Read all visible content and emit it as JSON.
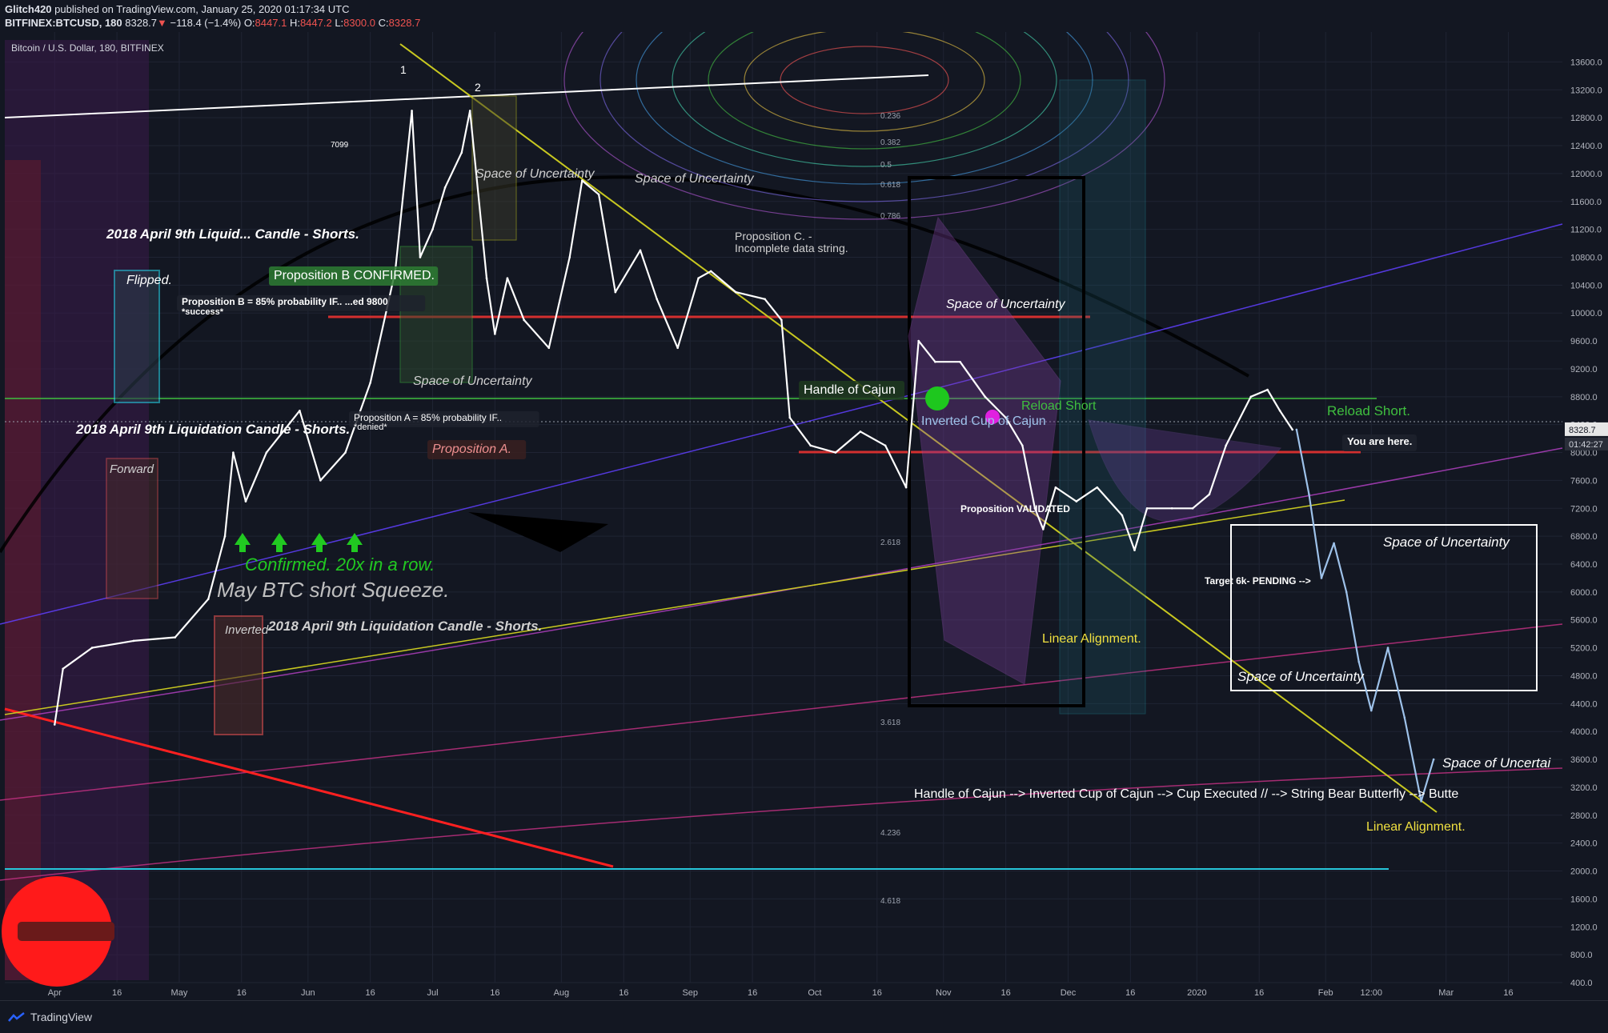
{
  "header": {
    "line1_user": "Glitch420",
    "line1_rest": " published on TradingView.com, January 25, 2020 01:17:34 UTC",
    "symbol": "BITFINEX:BTCUSD, 180",
    "last": "8328.7",
    "change": "−118.4 (−1.4%)",
    "o_label": "O:",
    "o": "8447.1",
    "h_label": "H:",
    "h": "8447.2",
    "l_label": "L:",
    "l": "8300.0",
    "c_label": "C:",
    "c": "8328.7"
  },
  "chart_title": "Bitcoin / U.S. Dollar, 180, BITFINEX",
  "footer": {
    "brand": "TradingView"
  },
  "colors": {
    "background": "#131722",
    "price_line": "#ffffff",
    "up": "#26a69a",
    "down": "#ef5350",
    "grid": "#1f2433"
  },
  "chart_data": {
    "type": "line",
    "title": "Bitcoin / U.S. Dollar, 180, BITFINEX",
    "xlabel": "",
    "ylabel": "",
    "ylim": [
      400,
      13800
    ],
    "y_ticks": [
      "13600.0",
      "13200.0",
      "12800.0",
      "12400.0",
      "12000.0",
      "11600.0",
      "11200.0",
      "10800.0",
      "10400.0",
      "10000.0",
      "9600.0",
      "9200.0",
      "8800.0",
      "8400.0",
      "8000.0",
      "7600.0",
      "7200.0",
      "6800.0",
      "6400.0",
      "6000.0",
      "5600.0",
      "5200.0",
      "4800.0",
      "4400.0",
      "4000.0",
      "3600.0",
      "3200.0",
      "2800.0",
      "2400.0",
      "2000.0",
      "1600.0",
      "1200.0",
      "800.0",
      "400.0"
    ],
    "x_ticks": [
      "Apr",
      "16",
      "May",
      "16",
      "Jun",
      "16",
      "Jul",
      "16",
      "Aug",
      "16",
      "Sep",
      "16",
      "Oct",
      "16",
      "Nov",
      "16",
      "Dec",
      "16",
      "2020",
      "16",
      "Feb",
      "12:00",
      "Mar",
      "16"
    ],
    "price_label": "8328.7",
    "countdown_label": "01:42:27",
    "series": [
      {
        "values": [
          [
            "2019-04-01",
            4100
          ],
          [
            "2019-04-03",
            4900
          ],
          [
            "2019-04-10",
            5200
          ],
          [
            "2019-04-20",
            5300
          ],
          [
            "2019-04-30",
            5350
          ],
          [
            "2019-05-08",
            5900
          ],
          [
            "2019-05-12",
            6800
          ],
          [
            "2019-05-14",
            8000
          ],
          [
            "2019-05-17",
            7300
          ],
          [
            "2019-05-22",
            8000
          ],
          [
            "2019-05-30",
            8600
          ],
          [
            "2019-06-04",
            7600
          ],
          [
            "2019-06-10",
            8000
          ],
          [
            "2019-06-16",
            9000
          ],
          [
            "2019-06-22",
            10600
          ],
          [
            "2019-06-26",
            12900
          ],
          [
            "2019-06-28",
            10800
          ],
          [
            "2019-07-01",
            11200
          ],
          [
            "2019-07-04",
            11800
          ],
          [
            "2019-07-08",
            12300
          ],
          [
            "2019-07-10",
            12900
          ],
          [
            "2019-07-14",
            10500
          ],
          [
            "2019-07-16",
            9700
          ],
          [
            "2019-07-19",
            10500
          ],
          [
            "2019-07-23",
            9900
          ],
          [
            "2019-07-29",
            9500
          ],
          [
            "2019-08-03",
            10800
          ],
          [
            "2019-08-06",
            11900
          ],
          [
            "2019-08-10",
            11700
          ],
          [
            "2019-08-14",
            10300
          ],
          [
            "2019-08-20",
            10900
          ],
          [
            "2019-08-24",
            10200
          ],
          [
            "2019-08-29",
            9500
          ],
          [
            "2019-09-03",
            10500
          ],
          [
            "2019-09-06",
            10600
          ],
          [
            "2019-09-12",
            10300
          ],
          [
            "2019-09-19",
            10200
          ],
          [
            "2019-09-23",
            9900
          ],
          [
            "2019-09-25",
            8500
          ],
          [
            "2019-09-30",
            8100
          ],
          [
            "2019-10-06",
            8000
          ],
          [
            "2019-10-12",
            8300
          ],
          [
            "2019-10-18",
            8100
          ],
          [
            "2019-10-23",
            7500
          ],
          [
            "2019-10-26",
            9600
          ],
          [
            "2019-10-30",
            9300
          ],
          [
            "2019-11-05",
            9300
          ],
          [
            "2019-11-11",
            8800
          ],
          [
            "2019-11-16",
            8500
          ],
          [
            "2019-11-20",
            8100
          ],
          [
            "2019-11-23",
            7200
          ],
          [
            "2019-11-25",
            6900
          ],
          [
            "2019-11-28",
            7500
          ],
          [
            "2019-12-03",
            7300
          ],
          [
            "2019-12-08",
            7500
          ],
          [
            "2019-12-14",
            7100
          ],
          [
            "2019-12-17",
            6600
          ],
          [
            "2019-12-20",
            7200
          ],
          [
            "2019-12-26",
            7200
          ],
          [
            "2019-12-31",
            7200
          ],
          [
            "2020-01-04",
            7400
          ],
          [
            "2020-01-08",
            8100
          ],
          [
            "2020-01-14",
            8800
          ],
          [
            "2020-01-18",
            8900
          ],
          [
            "2020-01-21",
            8600
          ],
          [
            "2020-01-24",
            8328.7
          ]
        ]
      },
      {
        "values": [
          [
            "2020-01-25",
            8328.7
          ],
          [
            "2020-01-28",
            7400
          ],
          [
            "2020-01-31",
            6200
          ],
          [
            "2020-02-03",
            6700
          ],
          [
            "2020-02-06",
            6000
          ],
          [
            "2020-02-09",
            5000
          ],
          [
            "2020-02-12",
            4300
          ],
          [
            "2020-02-16",
            5200
          ],
          [
            "2020-02-20",
            4200
          ],
          [
            "2020-02-24",
            3000
          ],
          [
            "2020-02-27",
            3600
          ]
        ]
      }
    ]
  },
  "annotations": [
    "2018 April 9th Liquid... Candle - Shorts.",
    "Flipped.",
    "2018 April 9th Liquidation Candle - Shorts.",
    "Forward",
    "Inverted",
    "2018 April 9th Liquidation Candle - Shorts.",
    "Confirmed. 20x in a row.",
    "May BTC short Squeeze.",
    "Proposition B CONFIRMED.",
    "Proposition B = 85% probability IF.. ...ed 9800",
    "*success*",
    "Proposition A = 85% probability IF..",
    "*denied*",
    "Proposition A.",
    "Space of Uncertainty",
    "Space of Uncertainty",
    "Space of Uncertainty",
    "Proposition C. -",
    "Incomplete data string.",
    "Handle of Cajun",
    "Inverted Cup of Cajun",
    "Reload Short",
    "Space of Uncertainty",
    "Proposition VALIDATED",
    "Linear Alignment.",
    "Reload Short.",
    "You are here.",
    "Space of Uncertainty",
    "Target 6k- PENDING -->",
    "Space of Uncertainty",
    "Space of Uncertai",
    "Handle of Cajun --> Inverted Cup of Cajun --> Cup Executed // --> String Bear Butterfly --> Butte",
    "Linear Alignment.",
    "1",
    "2",
    "7099"
  ],
  "fib_levels": [
    "0.236",
    "0.382",
    "0.5",
    "0.618",
    "0.786",
    "2.618",
    "3.618",
    "4.236",
    "4.618"
  ]
}
